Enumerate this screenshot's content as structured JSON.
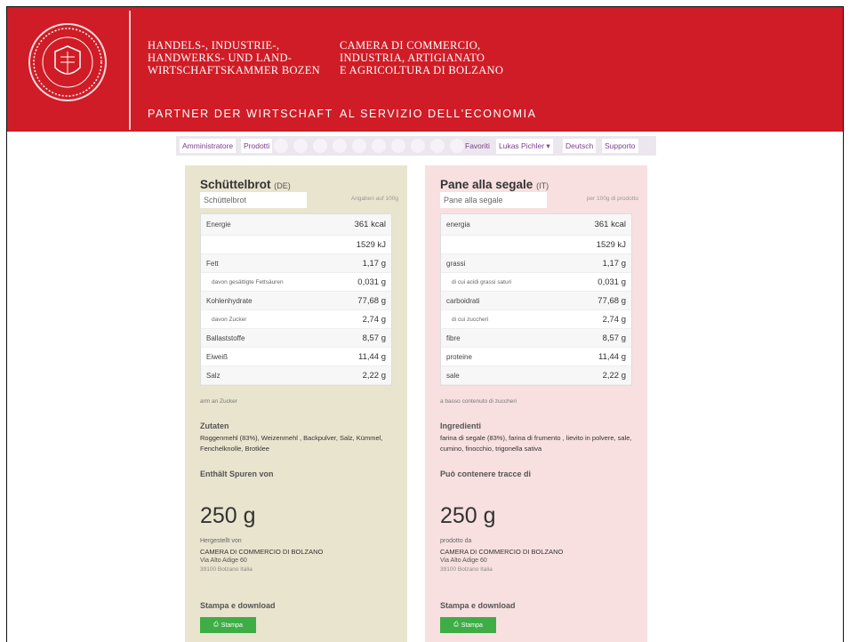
{
  "header": {
    "de_lines": [
      "HANDELS-, INDUSTRIE-,",
      "HANDWERKS- UND LAND-",
      "WIRTSCHAFTSKAMMER BOZEN"
    ],
    "it_lines": [
      "CAMERA DI COMMERCIO,",
      "INDUSTRIA, ARTIGIANATO",
      "E AGRICOLTURA DI BOLZANO"
    ],
    "de_slogan": "PARTNER DER WIRTSCHAFT",
    "it_slogan": "AL SERVIZIO DELL'ECONOMIA",
    "accent_color": "#d01c26"
  },
  "nav": {
    "admin": "Amministratore",
    "products": "Prodotti",
    "favorites": "Favoriti",
    "user": "Lukas Pichler ▾",
    "language": "Deutsch",
    "support": "Supporto"
  },
  "panel_de": {
    "title": "Schüttelbrot",
    "lang": "(DE)",
    "sub": "Schüttelbrot",
    "sub_right": "Angaben auf 100g",
    "rows": [
      {
        "label": "Energie",
        "value": "361 kcal"
      },
      {
        "label": "",
        "value": "1529 kJ"
      },
      {
        "label": "Fett",
        "value": "1,17 g"
      },
      {
        "label": "davon gesättigte Fettsäuren",
        "value": "0,031 g"
      },
      {
        "label": "Kohlenhydrate",
        "value": "77,68 g"
      },
      {
        "label": "davon Zucker",
        "value": "2,74 g"
      },
      {
        "label": "Ballaststoffe",
        "value": "8,57 g"
      },
      {
        "label": "Eiweiß",
        "value": "11,44 g"
      },
      {
        "label": "Salz",
        "value": "2,22 g"
      }
    ],
    "note": "arm an Zucker",
    "ingredients_heading": "Zutaten",
    "ingredients": "Roggenmehl (83%), Weizenmehl , Backpulver, Salz, Kümmel, Fenchelknolle, Brotklee",
    "traces_heading": "Enthält Spuren von",
    "weight": "250 g",
    "made_label": "Hergestellt von",
    "made_name": "CAMERA DI COMMERCIO DI BOLZANO",
    "made_addr1": "Via Alto Adige 60",
    "made_addr2": "39100 Bolzano Italia",
    "print_heading": "Stampa e download",
    "print_button": "Stampa"
  },
  "panel_it": {
    "title": "Pane alla segale",
    "lang": "(IT)",
    "sub": "Pane alla segale",
    "sub_right": "per 100g di prodotto",
    "rows": [
      {
        "label": "energia",
        "value": "361 kcal"
      },
      {
        "label": "",
        "value": "1529 kJ"
      },
      {
        "label": "grassi",
        "value": "1,17 g"
      },
      {
        "label": "di cui acidi grassi saturi",
        "value": "0,031 g"
      },
      {
        "label": "carboidrati",
        "value": "77,68 g"
      },
      {
        "label": "di cui zuccheri",
        "value": "2,74 g"
      },
      {
        "label": "fibre",
        "value": "8,57 g"
      },
      {
        "label": "proteine",
        "value": "11,44 g"
      },
      {
        "label": "sale",
        "value": "2,22 g"
      }
    ],
    "note": "a basso contenuto di zuccheri",
    "ingredients_heading": "Ingredienti",
    "ingredients": "farina di segale (83%), farina di frumento , lievito in polvere, sale, cumino, finocchio, trigonella sativa",
    "traces_heading": "Può contenere tracce di",
    "weight": "250 g",
    "made_label": "prodotto da",
    "made_name": "CAMERA DI COMMERCIO DI BOLZANO",
    "made_addr1": "Via Alto Adige 60",
    "made_addr2": "39100 Bolzano Italia",
    "print_heading": "Stampa e download",
    "print_button": "Stampa"
  }
}
